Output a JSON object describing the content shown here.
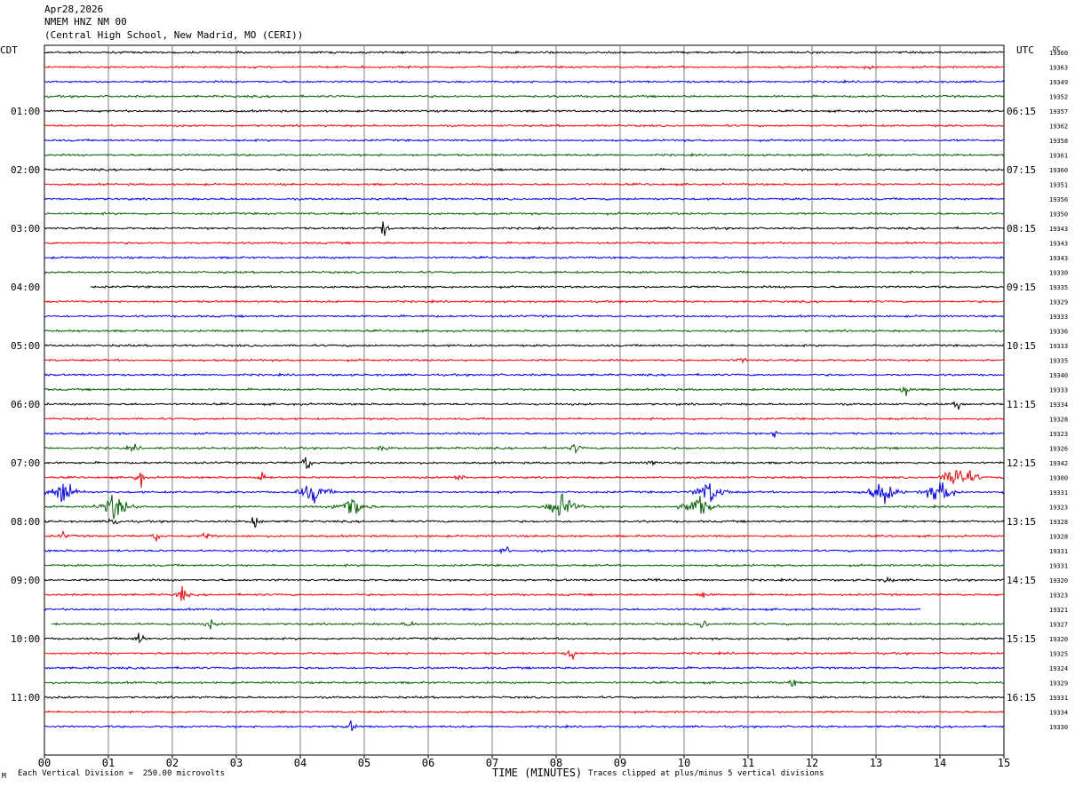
{
  "header": {
    "date": "Apr28,2026",
    "station": "NMEM HNZ NM 00",
    "location": "(Central High School, New Madrid, MO (CERI))"
  },
  "footer": {
    "scale_note": "Each Vertical Division =  250.00 microvolts",
    "clip_note": "Traces clipped at plus/minus 5 vertical divisions",
    "corner_symbol": "M"
  },
  "chart_data": {
    "type": "line",
    "title": "NMEM HNZ NM 00",
    "xlabel": "TIME (MINUTES)",
    "left_axis_label": "CDT",
    "right_axis_label": "UTC",
    "dc_label": "DC",
    "x_range": [
      0,
      15
    ],
    "x_ticks": [
      "00",
      "01",
      "02",
      "03",
      "04",
      "05",
      "06",
      "07",
      "08",
      "09",
      "10",
      "11",
      "12",
      "13",
      "14",
      "15"
    ],
    "vertical_grid": true,
    "trace_colors": [
      "#000000",
      "#ff0000",
      "#0000ff",
      "#006400"
    ],
    "cdt_labels": [
      "01:00",
      "02:00",
      "03:00",
      "04:00",
      "05:00",
      "06:00",
      "07:00",
      "08:00",
      "09:00",
      "10:00",
      "11:00"
    ],
    "utc_labels": [
      "06:15",
      "07:15",
      "08:15",
      "09:15",
      "10:15",
      "11:15",
      "12:15",
      "13:15",
      "14:15",
      "15:15",
      "16:15"
    ],
    "dc_values": [
      "19360",
      "19363",
      "19349",
      "19352",
      "19357",
      "19362",
      "19358",
      "19361",
      "19360",
      "19351",
      "19356",
      "19350",
      "19343",
      "19343",
      "19343",
      "19330",
      "19335",
      "19329",
      "19333",
      "19336",
      "19333",
      "19335",
      "19340",
      "19333",
      "19334",
      "19328",
      "19323",
      "19326",
      "19342",
      "19300",
      "19331",
      "19323",
      "19328",
      "19328",
      "19331",
      "19331",
      "19320",
      "19323",
      "19321",
      "19327",
      "19320",
      "19325",
      "19324",
      "19329",
      "19331",
      "19334",
      "19330"
    ],
    "events": [
      {
        "trace": 1,
        "minute": 12.9,
        "amp": 0.5
      },
      {
        "trace": 12,
        "minute": 5.3,
        "amp": 1.2
      },
      {
        "trace": 21,
        "minute": 10.9,
        "amp": 0.4
      },
      {
        "trace": 23,
        "minute": 13.45,
        "amp": 1.4
      },
      {
        "trace": 24,
        "minute": 14.3,
        "amp": 0.8
      },
      {
        "trace": 26,
        "minute": 11.4,
        "amp": 0.5
      },
      {
        "trace": 27,
        "minute": 1.4,
        "amp": 0.6
      },
      {
        "trace": 27,
        "minute": 5.3,
        "amp": 0.5
      },
      {
        "trace": 27,
        "minute": 8.3,
        "amp": 0.8
      },
      {
        "trace": 28,
        "minute": 4.1,
        "amp": 1.5
      },
      {
        "trace": 28,
        "minute": 9.5,
        "amp": 0.5
      },
      {
        "trace": 29,
        "minute": 1.5,
        "amp": 1.4
      },
      {
        "trace": 29,
        "minute": 3.4,
        "amp": 0.9
      },
      {
        "trace": 29,
        "minute": 6.5,
        "amp": 0.9
      },
      {
        "trace": 29,
        "minute": 14.3,
        "amp": 2.5
      },
      {
        "trace": 30,
        "minute": 0.3,
        "amp": 2.0
      },
      {
        "trace": 30,
        "minute": 4.2,
        "amp": 1.6
      },
      {
        "trace": 30,
        "minute": 10.4,
        "amp": 1.8
      },
      {
        "trace": 30,
        "minute": 13.1,
        "amp": 1.8
      },
      {
        "trace": 30,
        "minute": 14.0,
        "amp": 2.0
      },
      {
        "trace": 31,
        "minute": 1.1,
        "amp": 2.0
      },
      {
        "trace": 31,
        "minute": 4.8,
        "amp": 2.0
      },
      {
        "trace": 31,
        "minute": 8.1,
        "amp": 2.0
      },
      {
        "trace": 31,
        "minute": 10.2,
        "amp": 1.8
      },
      {
        "trace": 32,
        "minute": 1.1,
        "amp": 1.2
      },
      {
        "trace": 32,
        "minute": 3.3,
        "amp": 1.4
      },
      {
        "trace": 33,
        "minute": 0.3,
        "amp": 0.5
      },
      {
        "trace": 33,
        "minute": 1.75,
        "amp": 0.7
      },
      {
        "trace": 33,
        "minute": 2.55,
        "amp": 1.0
      },
      {
        "trace": 34,
        "minute": 7.2,
        "amp": 1.0
      },
      {
        "trace": 36,
        "minute": 9.5,
        "amp": 0.4
      },
      {
        "trace": 36,
        "minute": 13.2,
        "amp": 0.6
      },
      {
        "trace": 37,
        "minute": 2.15,
        "amp": 1.4
      },
      {
        "trace": 37,
        "minute": 10.3,
        "amp": 0.5
      },
      {
        "trace": 39,
        "minute": 2.6,
        "amp": 0.7
      },
      {
        "trace": 39,
        "minute": 5.7,
        "amp": 0.6
      },
      {
        "trace": 39,
        "minute": 10.3,
        "amp": 1.0
      },
      {
        "trace": 40,
        "minute": 1.5,
        "amp": 1.2
      },
      {
        "trace": 41,
        "minute": 8.25,
        "amp": 1.1
      },
      {
        "trace": 43,
        "minute": 11.7,
        "amp": 0.6
      },
      {
        "trace": 46,
        "minute": 4.8,
        "amp": 0.8
      }
    ],
    "gaps": [
      {
        "trace": 16,
        "from_minute": 0,
        "to_minute": 0.72
      },
      {
        "trace": 38,
        "from_minute": 13.7,
        "to_minute": 15
      },
      {
        "trace": 39,
        "from_minute": 0,
        "to_minute": 0.1
      }
    ]
  }
}
